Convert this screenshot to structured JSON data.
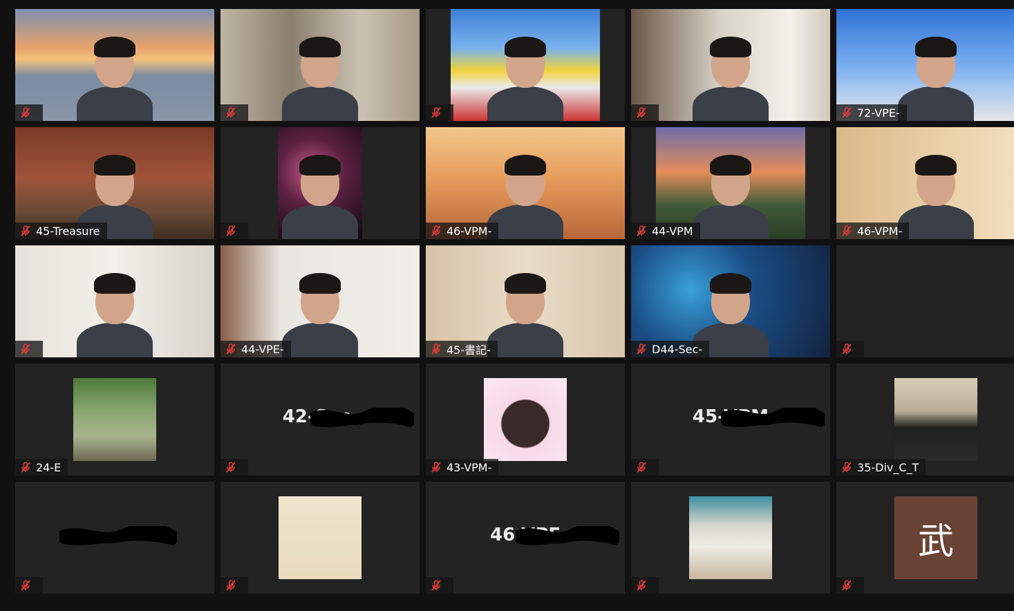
{
  "app": {
    "name": "Zoom gallery view"
  },
  "participants": [
    {
      "label": "",
      "muted": true,
      "kind": "video",
      "bg": "golden-gate"
    },
    {
      "label": "",
      "muted": true,
      "kind": "video",
      "bg": "room-curtain"
    },
    {
      "label": "",
      "muted": true,
      "kind": "video",
      "bg": "festival-street"
    },
    {
      "label": "",
      "muted": true,
      "kind": "video",
      "bg": "bright-room"
    },
    {
      "label": "72-VPE-",
      "muted": true,
      "kind": "video",
      "bg": "blue-sky-trees"
    },
    {
      "label": "45-Treasure",
      "muted": true,
      "kind": "video",
      "bg": "brick-cafe"
    },
    {
      "label": "",
      "muted": true,
      "kind": "video",
      "bg": "night-blossoms"
    },
    {
      "label": "46-VPM-",
      "muted": true,
      "kind": "video",
      "bg": "toastmasters-sunset"
    },
    {
      "label": "44-VPM",
      "muted": true,
      "kind": "video",
      "bg": "mountain-sunset"
    },
    {
      "label": "46-VPM-",
      "muted": true,
      "kind": "video",
      "bg": "beige-room"
    },
    {
      "label": "",
      "muted": true,
      "kind": "video",
      "bg": "white-room"
    },
    {
      "label": "44-VPE-",
      "muted": true,
      "kind": "video",
      "bg": "white-door-room"
    },
    {
      "label": "45-書記-",
      "muted": true,
      "kind": "video",
      "bg": "japanese-room"
    },
    {
      "label": "D44-Sec-",
      "muted": true,
      "kind": "video",
      "bg": "aquarium"
    },
    {
      "label": "",
      "muted": true,
      "kind": "empty"
    },
    {
      "label": "24-E",
      "muted": true,
      "kind": "avatar",
      "avatar": "hat-photo"
    },
    {
      "label": "",
      "muted": true,
      "kind": "text",
      "display_name": "42-Sec."
    },
    {
      "label": "43-VPM-",
      "muted": true,
      "kind": "avatar",
      "avatar": "heart-portrait"
    },
    {
      "label": "",
      "muted": true,
      "kind": "text",
      "display_name": "45-VPM"
    },
    {
      "label": "35-Div_C_T",
      "muted": true,
      "kind": "avatar",
      "avatar": "cat-photo"
    },
    {
      "label": "",
      "muted": true,
      "kind": "text",
      "display_name": ""
    },
    {
      "label": "",
      "muted": true,
      "kind": "avatar",
      "avatar": "frog-drawing"
    },
    {
      "label": "",
      "muted": true,
      "kind": "text",
      "display_name": "46-VPE"
    },
    {
      "label": "",
      "muted": true,
      "kind": "avatar",
      "avatar": "woman-photo"
    },
    {
      "label": "",
      "muted": true,
      "kind": "kanji",
      "kanji": "武"
    }
  ],
  "colors": {
    "window_bg": "#111111",
    "tile_bg": "#232323",
    "mute_red": "#e23b3b",
    "name_text": "#ffffff"
  },
  "icons": {
    "mute": "mic-muted-icon"
  }
}
